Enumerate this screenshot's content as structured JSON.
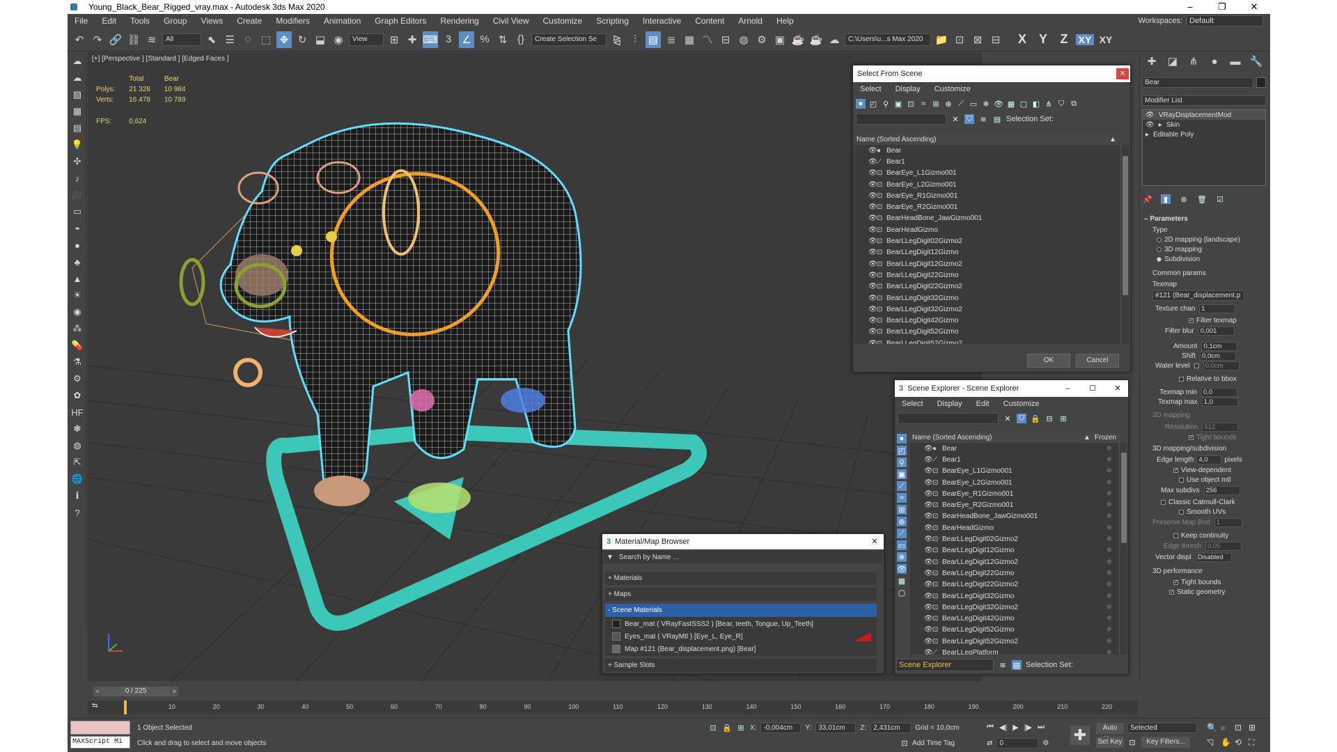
{
  "window": {
    "title": "Young_Black_Bear_Rigged_vray.max - Autodesk 3ds Max 2020",
    "minimize": "–",
    "maximize": "❐",
    "close": "✕"
  },
  "menu": [
    "File",
    "Edit",
    "Tools",
    "Group",
    "Views",
    "Create",
    "Modifiers",
    "Animation",
    "Graph Editors",
    "Rendering",
    "Civil View",
    "Customize",
    "Scripting",
    "Interactive",
    "Content",
    "Arnold",
    "Help"
  ],
  "workspace": {
    "label": "Workspaces:",
    "value": "Default"
  },
  "toolbar": {
    "filter": "All",
    "refcoord": "View",
    "selset": "Create Selection Se",
    "path": "C:\\Users\\u...s Max 2020",
    "axes": [
      "X",
      "Y",
      "Z",
      "XY",
      "XY"
    ]
  },
  "viewport": {
    "label": "[+] [Perspective ] [Standard ] [Edged Faces ]",
    "stats": {
      "col1": "Total",
      "col2": "Bear",
      "polys_label": "Polys:",
      "polys_total": "21 328",
      "polys_bear": "10 984",
      "verts_label": "Verts:",
      "verts_total": "16 478",
      "verts_bear": "10 789",
      "fps_label": "FPS:",
      "fps": "0,624"
    }
  },
  "select_dialog": {
    "title": "Select From Scene",
    "menu": [
      "Select",
      "Display",
      "Customize"
    ],
    "selection_set": "Selection Set:",
    "header": "Name (Sorted Ascending)",
    "items": [
      "Bear",
      "Bear1",
      "BearEye_L1Gizmo001",
      "BearEye_L2Gizmo001",
      "BearEye_R1Gizmo001",
      "BearEye_R2Gizmo001",
      "BearHeadBone_JawGizmo001",
      "BearHeadGizmo",
      "BearLLegDigit02Gizmo2",
      "BearLLegDigit12Gizmo",
      "BearLLegDigit12Gizmo2",
      "BearLLegDigit22Gizmo",
      "BearLLegDigit22Gizmo2",
      "BearLLegDigit32Gizmo",
      "BearLLegDigit32Gizmo2",
      "BearLLegDigit42Gizmo",
      "BearLLegDigit52Gizmo",
      "BearLLegDigit52Gizmo2"
    ],
    "ok": "OK",
    "cancel": "Cancel"
  },
  "scene_explorer": {
    "title": "Scene Explorer - Scene Explorer",
    "menu": [
      "Select",
      "Display",
      "Edit",
      "Customize"
    ],
    "header": "Name (Sorted Ascending)",
    "frozen": "Frozen",
    "items": [
      "Bear",
      "Bear1",
      "BearEye_L1Gizmo001",
      "BearEye_L2Gizmo001",
      "BearEye_R1Gizmo001",
      "BearEye_R2Gizmo001",
      "BearHeadBone_JawGizmo001",
      "BearHeadGizmo",
      "BearLLegDigit02Gizmo2",
      "BearLLegDigit12Gizmo",
      "BearLLegDigit12Gizmo2",
      "BearLLegDigit22Gizmo",
      "BearLLegDigit22Gizmo2",
      "BearLLegDigit32Gizmo",
      "BearLLegDigit32Gizmo2",
      "BearLLegDigit42Gizmo",
      "BearLLegDigit52Gizmo",
      "BearLLegDigit52Gizmo2",
      "BearLLegPlatform"
    ],
    "footer": "Scene Explorer",
    "selection_set": "Selection Set:"
  },
  "material_browser": {
    "title": "Material/Map Browser",
    "search": "Search by Name ...",
    "sections": [
      "+ Materials",
      "+ Maps",
      "- Scene Materials",
      "+ Sample Slots"
    ],
    "scene_materials": [
      "Bear_mat  ( VRayFastSSS2 ) [Bear, teeth, Tongue, Up_Teeth]",
      "Eyes_mat  ( VRayMtl ) [Eye_L, Eye_R]",
      "Map #121 (Bear_displacement.png) [Bear]"
    ]
  },
  "right_panel": {
    "object_name": "Bear",
    "modifier_list": "Modifier List",
    "stack": [
      "VRayDisplacementMod",
      "Skin",
      "Editable Poly"
    ],
    "parameters": "Parameters",
    "type_label": "Type",
    "type_opts": [
      "2D mapping (landscape)",
      "3D mapping",
      "Subdivision"
    ],
    "common": "Common params",
    "texmap_label": "Texmap",
    "texmap": "#121 (Bear_displacement.p",
    "texchan_label": "Texture chan",
    "texchan": "1",
    "filter_texmap": "Filter texmap",
    "filter_blur_label": "Filter blur",
    "filter_blur": "0,001",
    "amount_label": "Amount",
    "amount": "0,1cm",
    "shift_label": "Shift",
    "shift": "0,0cm",
    "water_label": "Water level",
    "water": "0,0cm",
    "rel_bbox": "Relative to bbox",
    "texmin_label": "Texmap min",
    "texmin": "0,0",
    "texmax_label": "Texmap max",
    "texmax": "1,0",
    "map2d": "2D mapping",
    "resolution_label": "Resolution",
    "resolution": "512",
    "tight_bounds": "Tight bounds",
    "map3d": "3D mapping/subdivision",
    "edge_len_label": "Edge length",
    "edge_len": "4,0",
    "pixels": "pixels",
    "view_dep": "View-dependent",
    "use_obj_mtl": "Use object mtl",
    "max_subdivs_label": "Max subdivs",
    "max_subdivs": "256",
    "catmull": "Classic Catmull-Clark",
    "smooth_uvs": "Smooth UVs",
    "preserve_label": "Preserve Map Bnd",
    "preserve": "1",
    "keep_cont": "Keep continuity",
    "edge_thresh_label": "Edge thresh",
    "edge_thresh": "0,05",
    "vector_label": "Vector displ",
    "vector": "Disabled",
    "perf": "3D performance",
    "tight_bounds2": "Tight bounds",
    "static_geo": "Static geometry"
  },
  "timeline": {
    "frame": "0 / 225",
    "ticks": [
      "10",
      "20",
      "30",
      "40",
      "50",
      "60",
      "70",
      "80",
      "90",
      "100",
      "110",
      "120",
      "130",
      "140",
      "150",
      "160",
      "170",
      "180",
      "190",
      "200",
      "210",
      "220"
    ]
  },
  "status": {
    "maxscript": "MAXScript Mi",
    "selected": "1 Object Selected",
    "hint": "Click and drag to select and move objects",
    "x_label": "X:",
    "x": "-0,004cm",
    "y_label": "Y:",
    "y": "33,01cm",
    "z_label": "Z:",
    "z": "2,431cm",
    "grid": "Grid = 10,0cm",
    "add_time_tag": "Add Time Tag",
    "frame_field": "0",
    "auto_key": "Auto Key",
    "set_key": "Set Key",
    "selected_dd": "Selected",
    "key_filters": "Key Filters..."
  }
}
